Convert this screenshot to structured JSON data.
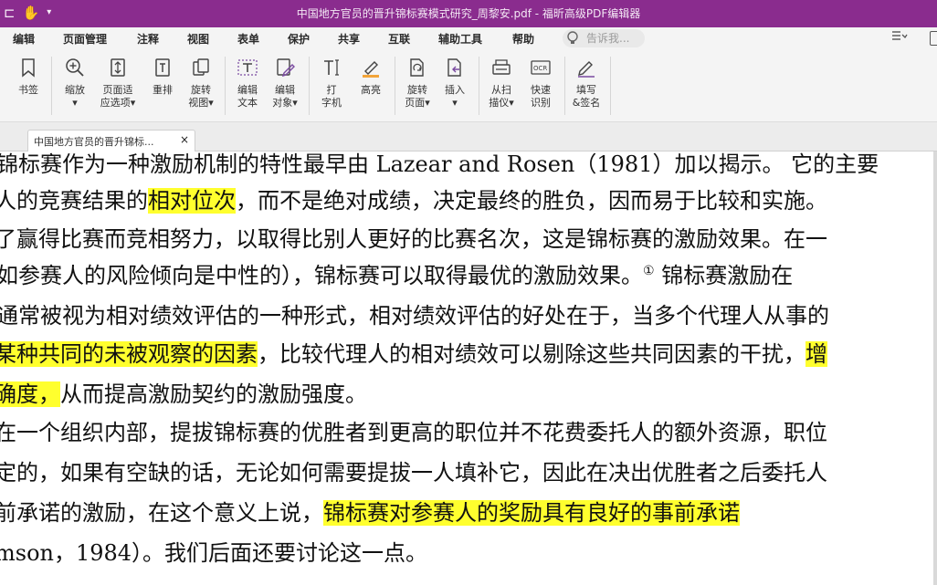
{
  "window": {
    "title": "中国地方官员的晋升锦标赛模式研究_周黎安.pdf - 福昕高级PDF编辑器",
    "quick_access": [
      "⊏",
      "✋",
      "▾",
      "≡"
    ]
  },
  "menu": {
    "items": [
      "编辑",
      "页面管理",
      "注释",
      "视图",
      "表单",
      "保护",
      "共享",
      "互联",
      "辅助工具",
      "帮助"
    ],
    "search_placeholder": "告诉我..."
  },
  "ribbon": {
    "tools": [
      {
        "line1": "书签",
        "line2": ""
      },
      {
        "line1": "缩放",
        "line2": "▾"
      },
      {
        "line1": "页面适",
        "line2": "应选项▾"
      },
      {
        "line1": "重排",
        "line2": ""
      },
      {
        "line1": "旋转",
        "line2": "视图▾"
      },
      {
        "line1": "编辑",
        "line2": "文本"
      },
      {
        "line1": "编辑",
        "line2": "对象▾"
      },
      {
        "line1": "打",
        "line2": "字机"
      },
      {
        "line1": "高亮",
        "line2": ""
      },
      {
        "line1": "旋转",
        "line2": "页面▾"
      },
      {
        "line1": "插入",
        "line2": "▾"
      },
      {
        "line1": "从扫",
        "line2": "描仪▾"
      },
      {
        "line1": "快速",
        "line2": "识别"
      },
      {
        "line1": "填写",
        "line2": "&签名"
      }
    ]
  },
  "tabs": [
    {
      "title": "中国地方官员的晋升锦标...",
      "close": "×"
    }
  ],
  "document": {
    "lines": [
      [
        {
          "t": "锦标赛作为一种激励机制的特性最早由 Lazear and Rosen（1981）加以揭示。 它的主要",
          "h": false
        }
      ],
      [
        {
          "t": "人的竞赛结果的",
          "h": false
        },
        {
          "t": "相对位次",
          "h": true
        },
        {
          "t": "，而不是绝对成绩，决定最终的胜负，因而易于比较和实施。",
          "h": false
        }
      ],
      [
        {
          "t": "了赢得比赛而竞相努力，以取得比别人更好的比赛名次，这是锦标赛的激励效果。在一",
          "h": false
        }
      ],
      [
        {
          "t": "如参赛人的风险倾向是中性的），锦标赛可以取得最优的激励效果。",
          "h": false
        },
        {
          "t": "①",
          "h": false,
          "sup": true
        },
        {
          "t": " 锦标赛激励在",
          "h": false
        }
      ],
      [
        {
          "t": "通常被视为相对绩效评估的一种形式，相对绩效评估的好处在于，当多个代理人从事的",
          "h": false
        }
      ],
      [
        {
          "t": "某种共同的未被观察的因素",
          "h": true
        },
        {
          "t": "，比较代理人的相对绩效可以剔除这些共同因素的干扰，",
          "h": false
        },
        {
          "t": "增",
          "h": true
        }
      ],
      [
        {
          "t": "确度，",
          "h": true
        },
        {
          "t": "从而提高激励契约的激励强度。",
          "h": false
        }
      ],
      [
        {
          "t": "在一个组织内部，提拔锦标赛的优胜者到更高的职位并不花费委托人的额外资源，职位",
          "h": false
        }
      ],
      [
        {
          "t": "定的，如果有空缺的话，无论如何需要提拔一人填补它，因此在决出优胜者之后委托人",
          "h": false
        }
      ],
      [
        {
          "t": "前承诺的激励，在这个意义上说，",
          "h": false
        },
        {
          "t": "锦标赛对参赛人的奖励具有良好的事前承诺",
          "h": true
        }
      ],
      [
        {
          "t": "mson，1984）。我们后面还要讨论这一点。",
          "h": false
        }
      ]
    ]
  }
}
